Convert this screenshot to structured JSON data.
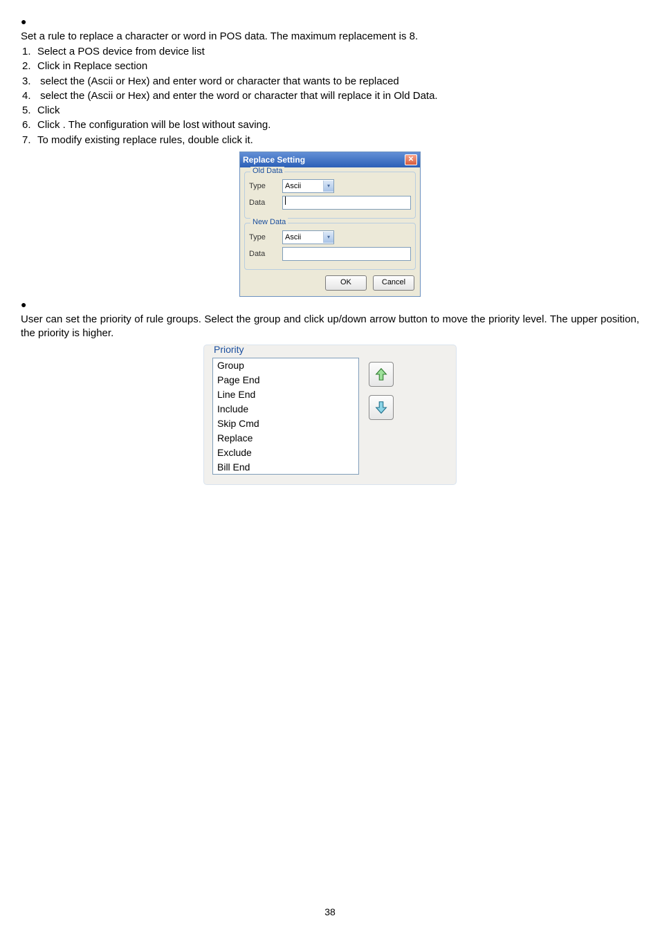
{
  "section1": {
    "bullet1": "●",
    "intro": "Set a rule to replace a character or word in POS data. The maximum replacement is 8.",
    "steps": [
      "Select a POS device from device list",
      "Click          in Replace section",
      "               select the         (Ascii or Hex) and enter word or character that wants to be replaced",
      "                select the           (Ascii or Hex) and enter the word or character that will replace it in Old Data.",
      "Click",
      "Click          . The configuration will be lost without saving.",
      "To modify existing replace rules, double click it."
    ]
  },
  "dialog": {
    "title": "Replace Setting",
    "old_legend": "Old Data",
    "new_legend": "New Data",
    "type_label": "Type",
    "data_label": "Data",
    "type_value": "Ascii",
    "ok": "OK",
    "cancel": "Cancel"
  },
  "section2": {
    "bullet2": "●",
    "desc": "User can set the priority of rule groups. Select the group and click up/down arrow button to move the priority level. The upper position, the priority is higher."
  },
  "priority": {
    "legend": "Priority",
    "items": [
      "Group",
      "Page End",
      "Line End",
      "Include",
      "Skip Cmd",
      "Replace",
      "Exclude",
      "Bill End"
    ]
  },
  "page_number": "38"
}
